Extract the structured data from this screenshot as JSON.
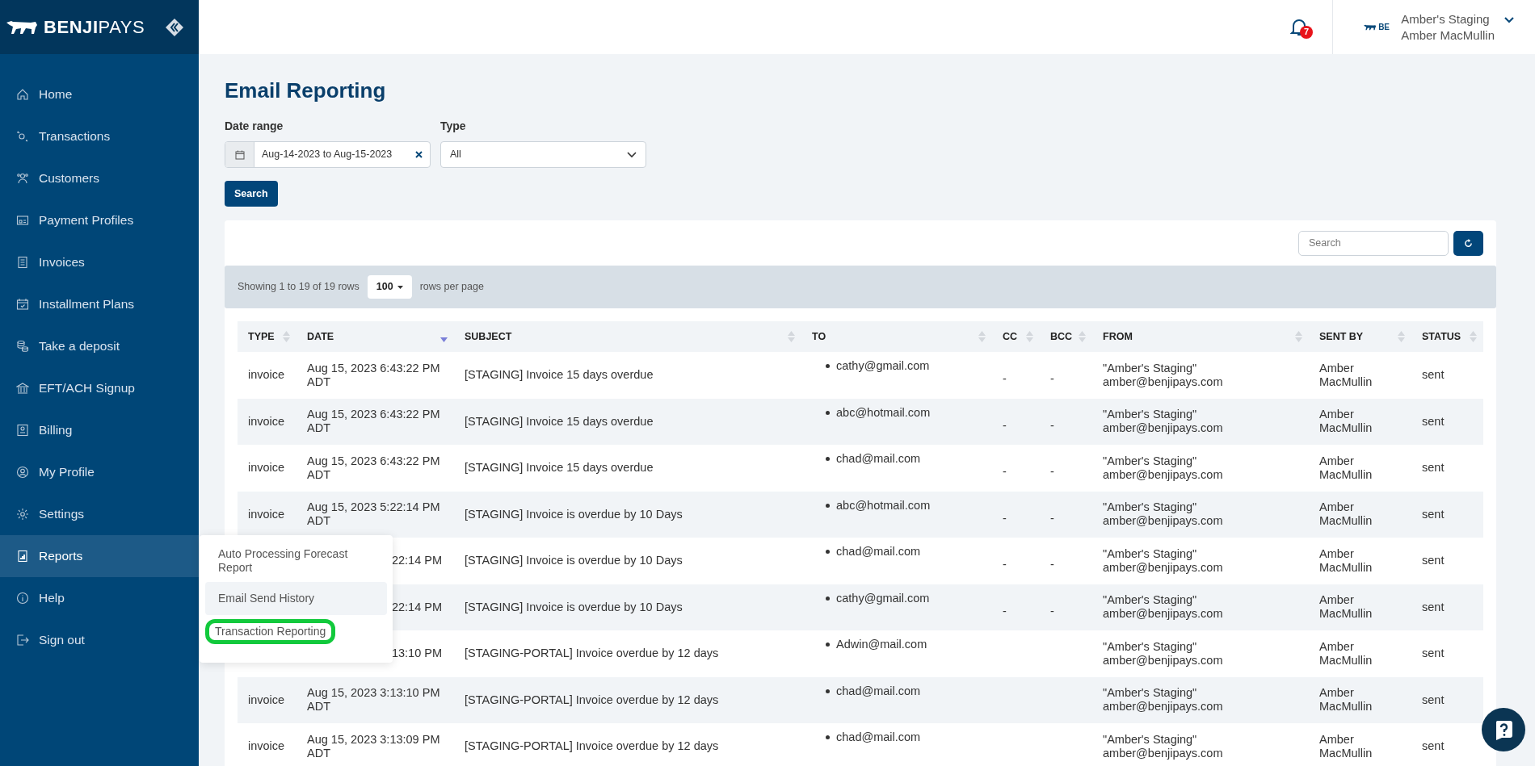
{
  "sidebar": {
    "logo": "**BENJI**PAYS",
    "items": [
      {
        "label": "Home",
        "selected": false
      },
      {
        "label": "Transactions",
        "selected": false
      },
      {
        "label": "Customers",
        "selected": false
      },
      {
        "label": "Payment Profiles",
        "selected": false
      },
      {
        "label": "Invoices",
        "selected": false
      },
      {
        "label": "Installment Plans",
        "selected": false
      },
      {
        "label": "Take a deposit",
        "selected": false
      },
      {
        "label": "EFT/ACH Signup",
        "selected": false
      },
      {
        "label": "Billing",
        "selected": false
      },
      {
        "label": "My Profile",
        "selected": false
      },
      {
        "label": "Settings",
        "selected": false
      },
      {
        "label": "Reports",
        "selected": true
      },
      {
        "label": "Help",
        "selected": false
      },
      {
        "label": "Sign out",
        "selected": false
      }
    ]
  },
  "header": {
    "notification_count": "7",
    "account": {
      "logo_text": "BE",
      "organization": "Amber's Staging",
      "user": "Amber MacMullin"
    }
  },
  "page_title": "Email Reporting",
  "filters": {
    "date_range": {
      "label": "Date range",
      "value": "Aug-14-2023 to Aug-15-2023"
    },
    "type": {
      "label": "Type",
      "value": "All"
    },
    "search_button": "Search"
  },
  "toolbar": {
    "search_placeholder": "Search"
  },
  "pagination": {
    "summary": "Showing 1 to 19 of 19 rows",
    "page_size": "100",
    "suffix": "rows per page"
  },
  "table": {
    "columns": [
      {
        "label": "TYPE",
        "sorted": false
      },
      {
        "label": "DATE",
        "sorted": true
      },
      {
        "label": "SUBJECT",
        "sorted": false
      },
      {
        "label": "TO",
        "sorted": false
      },
      {
        "label": "CC",
        "sorted": false
      },
      {
        "label": "BCC",
        "sorted": false
      },
      {
        "label": "FROM",
        "sorted": false
      },
      {
        "label": "SENT BY",
        "sorted": false
      },
      {
        "label": "STATUS",
        "sorted": false
      }
    ],
    "rows": [
      {
        "covered": false,
        "type": "invoice",
        "date": "Aug 15, 2023 6:43:22 PM ADT",
        "subject": "[STAGING] Invoice 15 days overdue",
        "to": "cathy@gmail.com",
        "cc": "-",
        "bcc": "-",
        "from": "\"Amber's Staging\" amber@benjipays.com",
        "sent_by": "Amber MacMullin",
        "status": "sent"
      },
      {
        "covered": false,
        "type": "invoice",
        "date": "Aug 15, 2023 6:43:22 PM ADT",
        "subject": "[STAGING] Invoice 15 days overdue",
        "to": "abc@hotmail.com",
        "cc": "-",
        "bcc": "-",
        "from": "\"Amber's Staging\" amber@benjipays.com",
        "sent_by": "Amber MacMullin",
        "status": "sent"
      },
      {
        "covered": false,
        "type": "invoice",
        "date": "Aug 15, 2023 6:43:22 PM ADT",
        "subject": "[STAGING] Invoice 15 days overdue",
        "to": "chad@mail.com",
        "cc": "-",
        "bcc": "-",
        "from": "\"Amber's Staging\" amber@benjipays.com",
        "sent_by": "Amber MacMullin",
        "status": "sent"
      },
      {
        "covered": false,
        "type": "invoice",
        "date": "Aug 15, 2023 5:22:14 PM ADT",
        "subject": "[STAGING] Invoice is overdue by 10 Days",
        "to": "abc@hotmail.com",
        "cc": "-",
        "bcc": "-",
        "from": "\"Amber's Staging\" amber@benjipays.com",
        "sent_by": "Amber MacMullin",
        "status": "sent"
      },
      {
        "covered": true,
        "date": "22:14 PM",
        "subject": "[STAGING] Invoice is overdue by 10 Days",
        "to": "chad@mail.com",
        "cc": "-",
        "bcc": "-",
        "from": "\"Amber's Staging\" amber@benjipays.com",
        "sent_by": "Amber MacMullin",
        "status": "sent"
      },
      {
        "covered": true,
        "date": "22:14 PM",
        "subject": "[STAGING] Invoice is overdue by 10 Days",
        "to": "cathy@gmail.com",
        "cc": "-",
        "bcc": "-",
        "from": "\"Amber's Staging\" amber@benjipays.com",
        "sent_by": "Amber MacMullin",
        "status": "sent"
      },
      {
        "covered": true,
        "date": "13:10 PM",
        "subject": "[STAGING-PORTAL] Invoice overdue by 12 days",
        "to": "Adwin@mail.com",
        "from": "\"Amber's Staging\" amber@benjipays.com",
        "sent_by": "Amber MacMullin",
        "status": "sent"
      },
      {
        "covered": false,
        "type": "invoice",
        "date": "Aug 15, 2023 3:13:10 PM ADT",
        "subject": "[STAGING-PORTAL] Invoice overdue by 12 days",
        "to": "chad@mail.com",
        "from": "\"Amber's Staging\" amber@benjipays.com",
        "sent_by": "Amber MacMullin",
        "status": "sent"
      },
      {
        "covered": false,
        "type": "invoice",
        "date": "Aug 15, 2023 3:13:09 PM ADT",
        "subject": "[STAGING-PORTAL] Invoice overdue by 12 days",
        "to": "chad@mail.com",
        "from": "\"Amber's Staging\" amber@benjipays.com",
        "sent_by": "Amber MacMullin",
        "status": "sent"
      }
    ]
  },
  "reports_menu": {
    "items": [
      {
        "label": "Auto Processing Forecast Report",
        "hovered": false,
        "circled": false
      },
      {
        "label": "Email Send History",
        "hovered": true,
        "circled": false
      },
      {
        "label": "Transaction Reporting",
        "hovered": false,
        "circled": true
      }
    ]
  }
}
